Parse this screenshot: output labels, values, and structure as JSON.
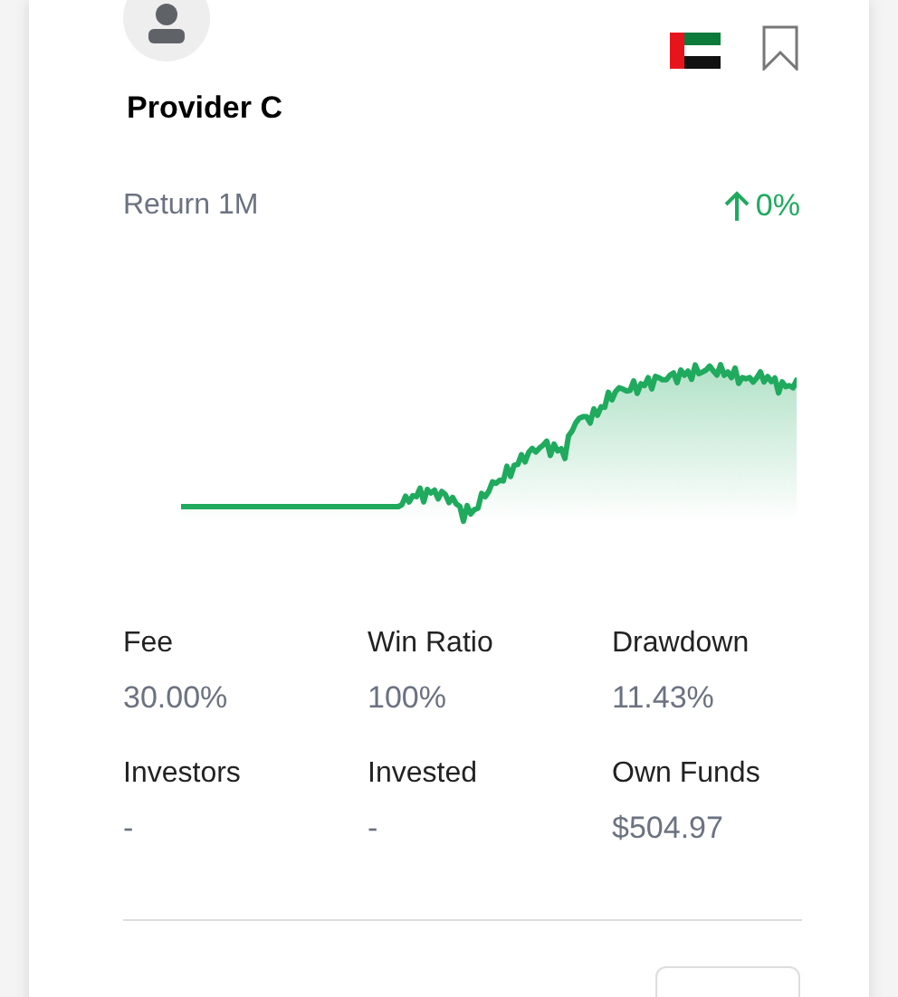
{
  "provider": {
    "name": "Provider C",
    "bookmarked": false
  },
  "return": {
    "label": "Return 1M",
    "value": "0%"
  },
  "stats": [
    {
      "label": "Fee",
      "value": "30.00%"
    },
    {
      "label": "Win Ratio",
      "value": "100%"
    },
    {
      "label": "Drawdown",
      "value": "11.43%"
    },
    {
      "label": "Investors",
      "value": "-"
    },
    {
      "label": "Invested",
      "value": "-"
    },
    {
      "label": "Own Funds",
      "value": "$504.97"
    }
  ]
}
